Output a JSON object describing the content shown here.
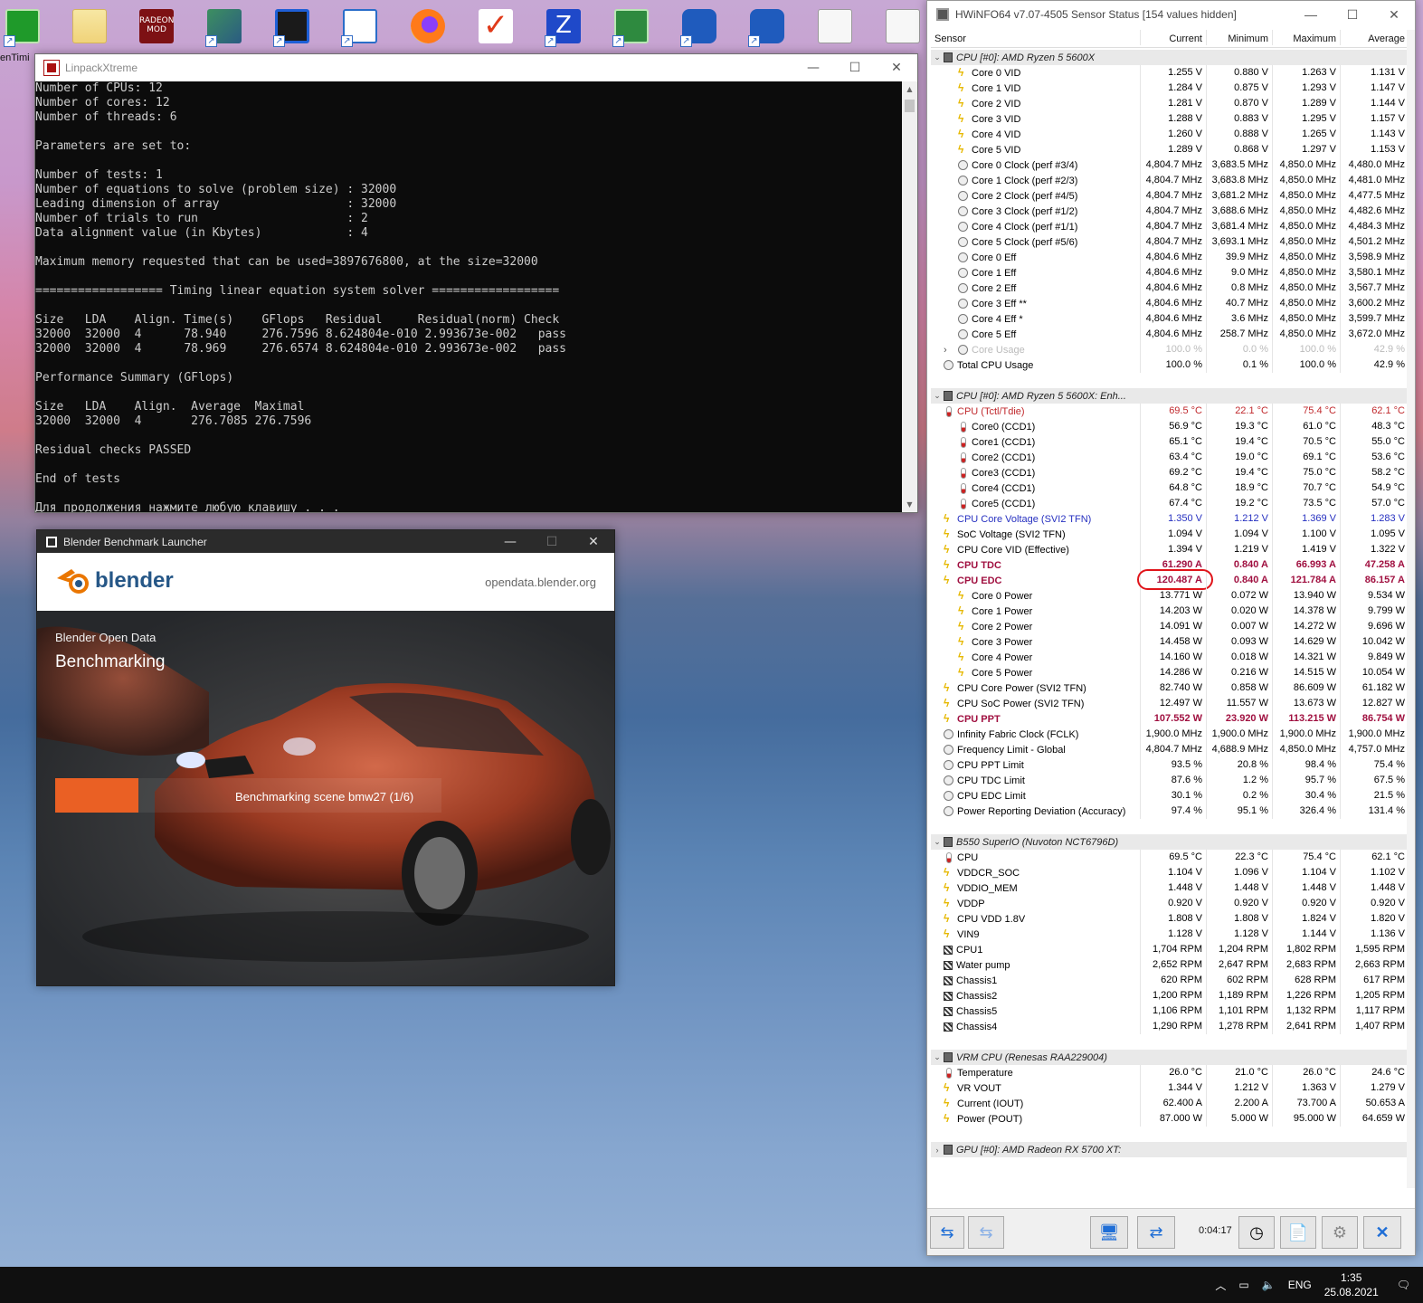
{
  "desktop": {
    "icons": [
      "green-z-app",
      "folder",
      "radeon-mod",
      "amd-shortcut",
      "remote-desktop",
      "window-app",
      "firefox",
      "checkmark-app",
      "cpu-z",
      "network-app",
      "hwinfo-a",
      "hwinfo-b",
      "document",
      "document-2"
    ],
    "partial_label": "enTimi",
    "radeon_label": "RADEON MOD"
  },
  "linpack": {
    "title": "LinpackXtreme",
    "lines": [
      "Number of CPUs: 12",
      "Number of cores: 12",
      "Number of threads: 6",
      "",
      "Parameters are set to:",
      "",
      "Number of tests: 1",
      "Number of equations to solve (problem size) : 32000",
      "Leading dimension of array                  : 32000",
      "Number of trials to run                     : 2",
      "Data alignment value (in Kbytes)            : 4",
      "",
      "Maximum memory requested that can be used=3897676800, at the size=32000",
      "",
      "================== Timing linear equation system solver ==================",
      "",
      "Size   LDA    Align. Time(s)    GFlops   Residual     Residual(norm) Check",
      "32000  32000  4      78.940     276.7596 8.624804e-010 2.993673e-002   pass",
      "32000  32000  4      78.969     276.6574 8.624804e-010 2.993673e-002   pass",
      "",
      "Performance Summary (GFlops)",
      "",
      "Size   LDA    Align.  Average  Maximal",
      "32000  32000  4       276.7085 276.7596",
      "",
      "Residual checks PASSED",
      "",
      "End of tests",
      "",
      "Для продолжения нажмите любую клавишу . . ."
    ]
  },
  "blender": {
    "title": "Blender Benchmark Launcher",
    "logo_text": "blender",
    "url": "opendata.blender.org",
    "subtitle": "Blender Open Data",
    "heading": "Benchmarking",
    "status": "Benchmarking scene bmw27 (1/6)",
    "progress": "1/6"
  },
  "hwinfo": {
    "title": "HWiNFO64 v7.07-4505 Sensor Status [154 values hidden]",
    "columns": [
      "Sensor",
      "Current",
      "Minimum",
      "Maximum",
      "Average"
    ],
    "rows": [
      {
        "t": "group",
        "name": "CPU [#0]: AMD Ryzen 5 5600X",
        "exp": "⌄"
      },
      {
        "t": "item",
        "icon": "volt",
        "ind": 2,
        "name": "Core 0 VID",
        "v": [
          "1.255 V",
          "0.880 V",
          "1.263 V",
          "1.131 V"
        ]
      },
      {
        "t": "item",
        "icon": "volt",
        "ind": 2,
        "name": "Core 1 VID",
        "v": [
          "1.284 V",
          "0.875 V",
          "1.293 V",
          "1.147 V"
        ]
      },
      {
        "t": "item",
        "icon": "volt",
        "ind": 2,
        "name": "Core 2 VID",
        "v": [
          "1.281 V",
          "0.870 V",
          "1.289 V",
          "1.144 V"
        ]
      },
      {
        "t": "item",
        "icon": "volt",
        "ind": 2,
        "name": "Core 3 VID",
        "v": [
          "1.288 V",
          "0.883 V",
          "1.295 V",
          "1.157 V"
        ]
      },
      {
        "t": "item",
        "icon": "volt",
        "ind": 2,
        "name": "Core 4 VID",
        "v": [
          "1.260 V",
          "0.888 V",
          "1.265 V",
          "1.143 V"
        ]
      },
      {
        "t": "item",
        "icon": "volt",
        "ind": 2,
        "name": "Core 5 VID",
        "v": [
          "1.289 V",
          "0.868 V",
          "1.297 V",
          "1.153 V"
        ]
      },
      {
        "t": "item",
        "icon": "clock",
        "ind": 2,
        "name": "Core 0 Clock (perf #3/4)",
        "v": [
          "4,804.7 MHz",
          "3,683.5 MHz",
          "4,850.0 MHz",
          "4,480.0 MHz"
        ]
      },
      {
        "t": "item",
        "icon": "clock",
        "ind": 2,
        "name": "Core 1 Clock (perf #2/3)",
        "v": [
          "4,804.7 MHz",
          "3,683.8 MHz",
          "4,850.0 MHz",
          "4,481.0 MHz"
        ]
      },
      {
        "t": "item",
        "icon": "clock",
        "ind": 2,
        "name": "Core 2 Clock (perf #4/5)",
        "v": [
          "4,804.7 MHz",
          "3,681.2 MHz",
          "4,850.0 MHz",
          "4,477.5 MHz"
        ]
      },
      {
        "t": "item",
        "icon": "clock",
        "ind": 2,
        "name": "Core 3 Clock (perf #1/2)",
        "v": [
          "4,804.7 MHz",
          "3,688.6 MHz",
          "4,850.0 MHz",
          "4,482.6 MHz"
        ]
      },
      {
        "t": "item",
        "icon": "clock",
        "ind": 2,
        "name": "Core 4 Clock (perf #1/1)",
        "v": [
          "4,804.7 MHz",
          "3,681.4 MHz",
          "4,850.0 MHz",
          "4,484.3 MHz"
        ]
      },
      {
        "t": "item",
        "icon": "clock",
        "ind": 2,
        "name": "Core 5 Clock (perf #5/6)",
        "v": [
          "4,804.7 MHz",
          "3,693.1 MHz",
          "4,850.0 MHz",
          "4,501.2 MHz"
        ]
      },
      {
        "t": "item",
        "icon": "clock",
        "ind": 2,
        "name": "Core 0  Eff",
        "v": [
          "4,804.6 MHz",
          "39.9 MHz",
          "4,850.0 MHz",
          "3,598.9 MHz"
        ]
      },
      {
        "t": "item",
        "icon": "clock",
        "ind": 2,
        "name": "Core 1  Eff",
        "v": [
          "4,804.6 MHz",
          "9.0 MHz",
          "4,850.0 MHz",
          "3,580.1 MHz"
        ]
      },
      {
        "t": "item",
        "icon": "clock",
        "ind": 2,
        "name": "Core 2  Eff",
        "v": [
          "4,804.6 MHz",
          "0.8 MHz",
          "4,850.0 MHz",
          "3,567.7 MHz"
        ]
      },
      {
        "t": "item",
        "icon": "clock",
        "ind": 2,
        "name": "Core 3  Eff **",
        "v": [
          "4,804.6 MHz",
          "40.7 MHz",
          "4,850.0 MHz",
          "3,600.2 MHz"
        ]
      },
      {
        "t": "item",
        "icon": "clock",
        "ind": 2,
        "name": "Core 4  Eff *",
        "v": [
          "4,804.6 MHz",
          "3.6 MHz",
          "4,850.0 MHz",
          "3,599.7 MHz"
        ]
      },
      {
        "t": "item",
        "icon": "clock",
        "ind": 2,
        "name": "Core 5  Eff",
        "v": [
          "4,804.6 MHz",
          "258.7 MHz",
          "4,850.0 MHz",
          "3,672.0 MHz"
        ]
      },
      {
        "t": "item",
        "icon": "clock",
        "ind": 2,
        "exp": "›",
        "style": "disabled",
        "name": "Core Usage",
        "v": [
          "100.0 %",
          "0.0 %",
          "100.0 %",
          "42.9 %"
        ]
      },
      {
        "t": "item",
        "icon": "clock",
        "ind": 1,
        "name": "Total CPU Usage",
        "v": [
          "100.0 %",
          "0.1 %",
          "100.0 %",
          "42.9 %"
        ]
      },
      {
        "t": "blank"
      },
      {
        "t": "group",
        "name": "CPU [#0]: AMD Ryzen 5 5600X: Enh...",
        "exp": "⌄"
      },
      {
        "t": "item",
        "icon": "temp",
        "ind": 1,
        "style": "red",
        "name": "CPU (Tctl/Tdie)",
        "v": [
          "69.5 °C",
          "22.1 °C",
          "75.4 °C",
          "62.1 °C"
        ]
      },
      {
        "t": "item",
        "icon": "temp",
        "ind": 2,
        "name": "Core0 (CCD1)",
        "v": [
          "56.9 °C",
          "19.3 °C",
          "61.0 °C",
          "48.3 °C"
        ]
      },
      {
        "t": "item",
        "icon": "temp",
        "ind": 2,
        "name": "Core1 (CCD1)",
        "v": [
          "65.1 °C",
          "19.4 °C",
          "70.5 °C",
          "55.0 °C"
        ]
      },
      {
        "t": "item",
        "icon": "temp",
        "ind": 2,
        "name": "Core2 (CCD1)",
        "v": [
          "63.4 °C",
          "19.0 °C",
          "69.1 °C",
          "53.6 °C"
        ]
      },
      {
        "t": "item",
        "icon": "temp",
        "ind": 2,
        "name": "Core3 (CCD1)",
        "v": [
          "69.2 °C",
          "19.4 °C",
          "75.0 °C",
          "58.2 °C"
        ]
      },
      {
        "t": "item",
        "icon": "temp",
        "ind": 2,
        "name": "Core4 (CCD1)",
        "v": [
          "64.8 °C",
          "18.9 °C",
          "70.7 °C",
          "54.9 °C"
        ]
      },
      {
        "t": "item",
        "icon": "temp",
        "ind": 2,
        "name": "Core5 (CCD1)",
        "v": [
          "67.4 °C",
          "19.2 °C",
          "73.5 °C",
          "57.0 °C"
        ]
      },
      {
        "t": "item",
        "icon": "volt",
        "ind": 1,
        "style": "blue",
        "name": "CPU Core Voltage (SVI2 TFN)",
        "v": [
          "1.350 V",
          "1.212 V",
          "1.369 V",
          "1.283 V"
        ]
      },
      {
        "t": "item",
        "icon": "volt",
        "ind": 1,
        "name": "SoC Voltage (SVI2 TFN)",
        "v": [
          "1.094 V",
          "1.094 V",
          "1.100 V",
          "1.095 V"
        ]
      },
      {
        "t": "item",
        "icon": "volt",
        "ind": 1,
        "name": "CPU Core VID (Effective)",
        "v": [
          "1.394 V",
          "1.219 V",
          "1.419 V",
          "1.322 V"
        ]
      },
      {
        "t": "item",
        "icon": "volt",
        "ind": 1,
        "style": "bold-red",
        "name": "CPU TDC",
        "v": [
          "61.290 A",
          "0.840 A",
          "66.993 A",
          "47.258 A"
        ]
      },
      {
        "t": "item",
        "icon": "volt",
        "ind": 1,
        "style": "bold-red",
        "circled": true,
        "name": "CPU EDC",
        "v": [
          "120.487 A",
          "0.840 A",
          "121.784 A",
          "86.157 A"
        ]
      },
      {
        "t": "item",
        "icon": "volt",
        "ind": 2,
        "name": "Core 0 Power",
        "v": [
          "13.771 W",
          "0.072 W",
          "13.940 W",
          "9.534 W"
        ]
      },
      {
        "t": "item",
        "icon": "volt",
        "ind": 2,
        "name": "Core 1 Power",
        "v": [
          "14.203 W",
          "0.020 W",
          "14.378 W",
          "9.799 W"
        ]
      },
      {
        "t": "item",
        "icon": "volt",
        "ind": 2,
        "name": "Core 2 Power",
        "v": [
          "14.091 W",
          "0.007 W",
          "14.272 W",
          "9.696 W"
        ]
      },
      {
        "t": "item",
        "icon": "volt",
        "ind": 2,
        "name": "Core 3 Power",
        "v": [
          "14.458 W",
          "0.093 W",
          "14.629 W",
          "10.042 W"
        ]
      },
      {
        "t": "item",
        "icon": "volt",
        "ind": 2,
        "name": "Core 4 Power",
        "v": [
          "14.160 W",
          "0.018 W",
          "14.321 W",
          "9.849 W"
        ]
      },
      {
        "t": "item",
        "icon": "volt",
        "ind": 2,
        "name": "Core 5 Power",
        "v": [
          "14.286 W",
          "0.216 W",
          "14.515 W",
          "10.054 W"
        ]
      },
      {
        "t": "item",
        "icon": "volt",
        "ind": 1,
        "name": "CPU Core Power (SVI2 TFN)",
        "v": [
          "82.740 W",
          "0.858 W",
          "86.609 W",
          "61.182 W"
        ]
      },
      {
        "t": "item",
        "icon": "volt",
        "ind": 1,
        "name": "CPU SoC Power (SVI2 TFN)",
        "v": [
          "12.497 W",
          "11.557 W",
          "13.673 W",
          "12.827 W"
        ]
      },
      {
        "t": "item",
        "icon": "volt",
        "ind": 1,
        "style": "bold-red",
        "name": "CPU PPT",
        "v": [
          "107.552 W",
          "23.920 W",
          "113.215 W",
          "86.754 W"
        ]
      },
      {
        "t": "item",
        "icon": "clock",
        "ind": 1,
        "name": "Infinity Fabric Clock (FCLK)",
        "v": [
          "1,900.0 MHz",
          "1,900.0 MHz",
          "1,900.0 MHz",
          "1,900.0 MHz"
        ]
      },
      {
        "t": "item",
        "icon": "clock",
        "ind": 1,
        "name": "Frequency Limit - Global",
        "v": [
          "4,804.7 MHz",
          "4,688.9 MHz",
          "4,850.0 MHz",
          "4,757.0 MHz"
        ]
      },
      {
        "t": "item",
        "icon": "clock",
        "ind": 1,
        "name": "CPU PPT Limit",
        "v": [
          "93.5 %",
          "20.8 %",
          "98.4 %",
          "75.4 %"
        ]
      },
      {
        "t": "item",
        "icon": "clock",
        "ind": 1,
        "name": "CPU TDC Limit",
        "v": [
          "87.6 %",
          "1.2 %",
          "95.7 %",
          "67.5 %"
        ]
      },
      {
        "t": "item",
        "icon": "clock",
        "ind": 1,
        "name": "CPU EDC Limit",
        "v": [
          "30.1 %",
          "0.2 %",
          "30.4 %",
          "21.5 %"
        ]
      },
      {
        "t": "item",
        "icon": "clock",
        "ind": 1,
        "name": "Power Reporting Deviation (Accuracy)",
        "v": [
          "97.4 %",
          "95.1 %",
          "326.4 %",
          "131.4 %"
        ]
      },
      {
        "t": "blank"
      },
      {
        "t": "group",
        "name": "B550 SuperIO (Nuvoton NCT6796D)",
        "exp": "⌄"
      },
      {
        "t": "item",
        "icon": "temp",
        "ind": 1,
        "name": "CPU",
        "v": [
          "69.5 °C",
          "22.3 °C",
          "75.4 °C",
          "62.1 °C"
        ]
      },
      {
        "t": "item",
        "icon": "volt",
        "ind": 1,
        "name": "VDDCR_SOC",
        "v": [
          "1.104 V",
          "1.096 V",
          "1.104 V",
          "1.102 V"
        ]
      },
      {
        "t": "item",
        "icon": "volt",
        "ind": 1,
        "name": "VDDIO_MEM",
        "v": [
          "1.448 V",
          "1.448 V",
          "1.448 V",
          "1.448 V"
        ]
      },
      {
        "t": "item",
        "icon": "volt",
        "ind": 1,
        "name": "VDDP",
        "v": [
          "0.920 V",
          "0.920 V",
          "0.920 V",
          "0.920 V"
        ]
      },
      {
        "t": "item",
        "icon": "volt",
        "ind": 1,
        "name": "CPU VDD 1.8V",
        "v": [
          "1.808 V",
          "1.808 V",
          "1.824 V",
          "1.820 V"
        ]
      },
      {
        "t": "item",
        "icon": "volt",
        "ind": 1,
        "name": "VIN9",
        "v": [
          "1.128 V",
          "1.128 V",
          "1.144 V",
          "1.136 V"
        ]
      },
      {
        "t": "item",
        "icon": "fan",
        "ind": 1,
        "name": "CPU1",
        "v": [
          "1,704 RPM",
          "1,204 RPM",
          "1,802 RPM",
          "1,595 RPM"
        ]
      },
      {
        "t": "item",
        "icon": "fan",
        "ind": 1,
        "name": "Water pump",
        "v": [
          "2,652 RPM",
          "2,647 RPM",
          "2,683 RPM",
          "2,663 RPM"
        ]
      },
      {
        "t": "item",
        "icon": "fan",
        "ind": 1,
        "name": "Chassis1",
        "v": [
          "620 RPM",
          "602 RPM",
          "628 RPM",
          "617 RPM"
        ]
      },
      {
        "t": "item",
        "icon": "fan",
        "ind": 1,
        "name": "Chassis2",
        "v": [
          "1,200 RPM",
          "1,189 RPM",
          "1,226 RPM",
          "1,205 RPM"
        ]
      },
      {
        "t": "item",
        "icon": "fan",
        "ind": 1,
        "name": "Chassis5",
        "v": [
          "1,106 RPM",
          "1,101 RPM",
          "1,132 RPM",
          "1,117 RPM"
        ]
      },
      {
        "t": "item",
        "icon": "fan",
        "ind": 1,
        "name": "Chassis4",
        "v": [
          "1,290 RPM",
          "1,278 RPM",
          "2,641 RPM",
          "1,407 RPM"
        ]
      },
      {
        "t": "blank"
      },
      {
        "t": "group",
        "name": "VRM CPU (Renesas RAA229004)",
        "exp": "⌄"
      },
      {
        "t": "item",
        "icon": "temp",
        "ind": 1,
        "name": "Temperature",
        "v": [
          "26.0 °C",
          "21.0 °C",
          "26.0 °C",
          "24.6 °C"
        ]
      },
      {
        "t": "item",
        "icon": "volt",
        "ind": 1,
        "name": "VR VOUT",
        "v": [
          "1.344 V",
          "1.212 V",
          "1.363 V",
          "1.279 V"
        ]
      },
      {
        "t": "item",
        "icon": "volt",
        "ind": 1,
        "name": "Current (IOUT)",
        "v": [
          "62.400 A",
          "2.200 A",
          "73.700 A",
          "50.653 A"
        ]
      },
      {
        "t": "item",
        "icon": "volt",
        "ind": 1,
        "name": "Power (POUT)",
        "v": [
          "87.000 W",
          "5.000 W",
          "95.000 W",
          "64.659 W"
        ]
      },
      {
        "t": "blank"
      },
      {
        "t": "group",
        "name": "GPU [#0]: AMD Radeon RX 5700 XT:",
        "exp": "›"
      }
    ],
    "timer": "0:04:17"
  },
  "taskbar": {
    "lang": "ENG",
    "time": "1:35",
    "date": "25.08.2021"
  }
}
